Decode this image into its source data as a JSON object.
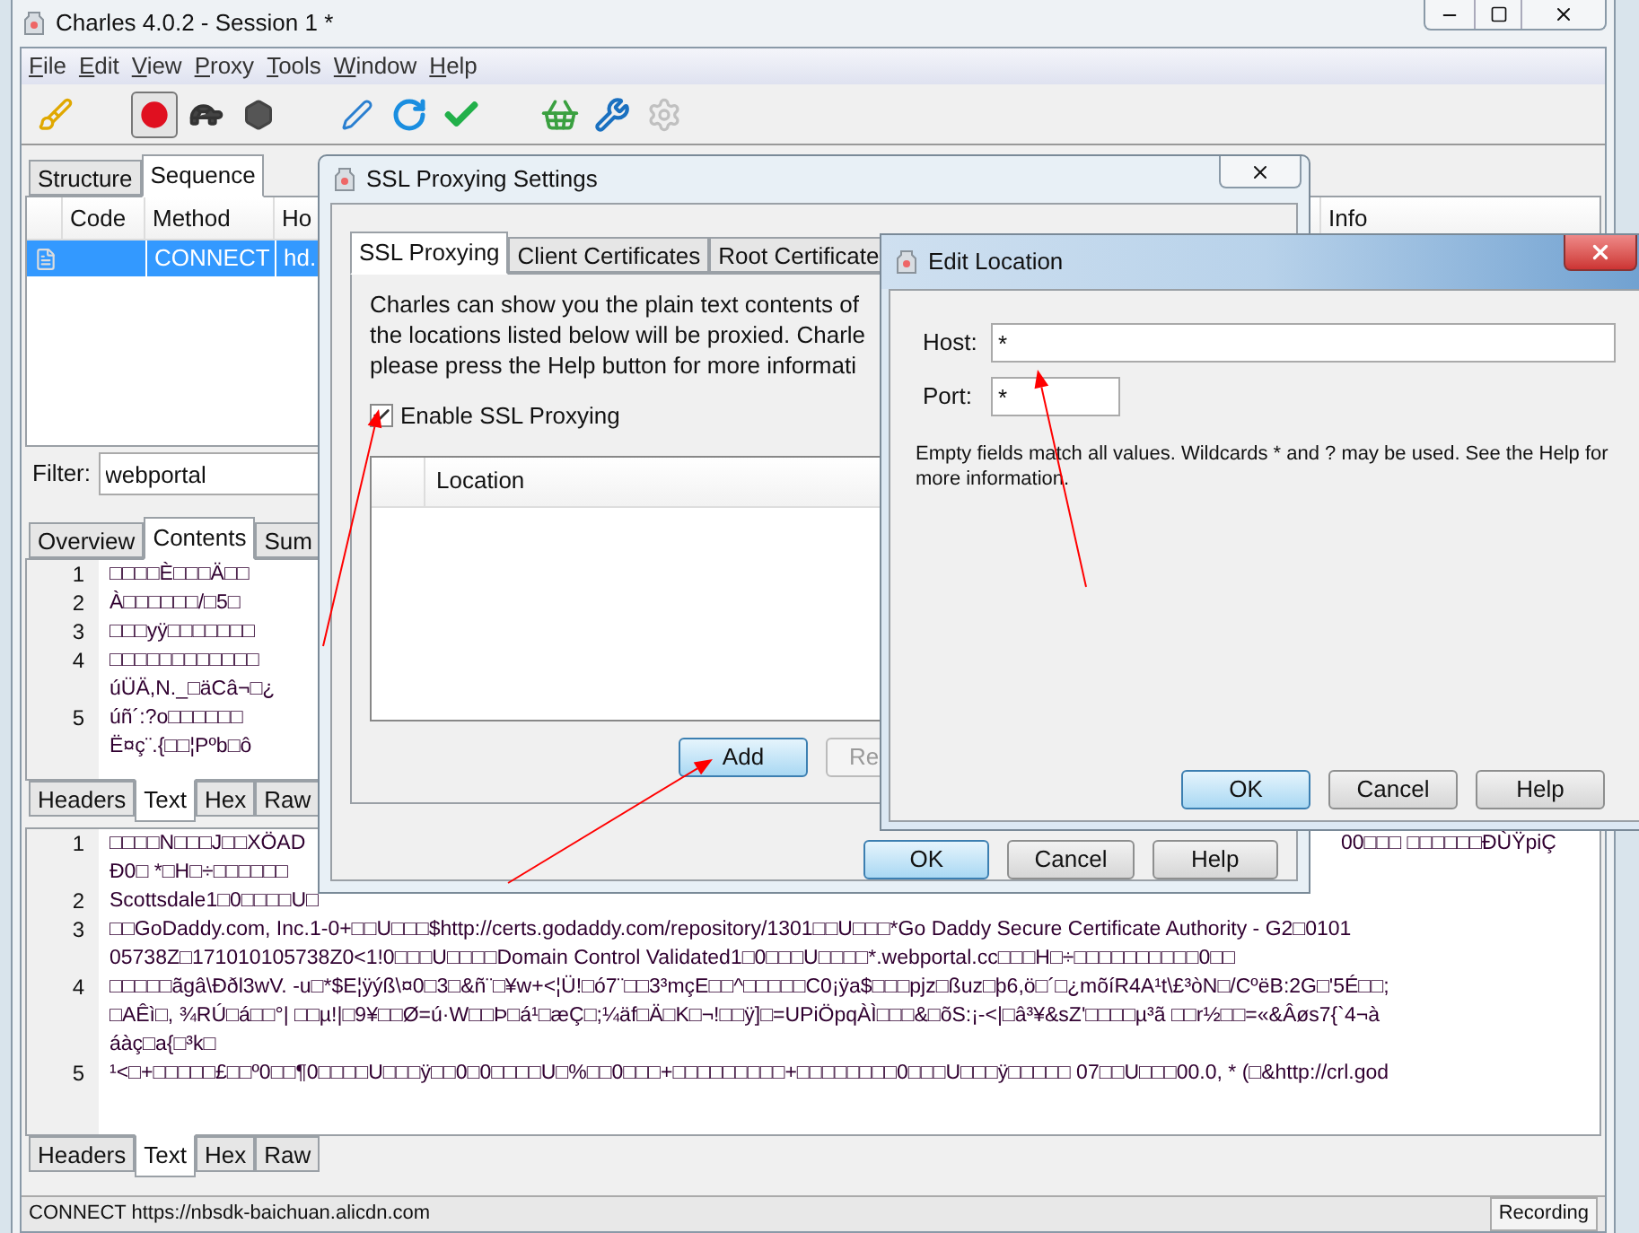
{
  "window": {
    "title": "Charles 4.0.2 - Session 1 *"
  },
  "menu": [
    "File",
    "Edit",
    "View",
    "Proxy",
    "Tools",
    "Window",
    "Help"
  ],
  "toolbar": [
    {
      "pressed": false,
      "disabled": false
    },
    {
      "pressed": true,
      "disabled": false
    },
    {
      "pressed": false,
      "disabled": false
    },
    {
      "pressed": false,
      "disabled": false
    },
    {
      "pressed": false,
      "disabled": false
    },
    {
      "pressed": false,
      "disabled": false
    },
    {
      "pressed": false,
      "disabled": false
    },
    {
      "pressed": false,
      "disabled": false
    },
    {
      "pressed": false,
      "disabled": false
    },
    {
      "pressed": false,
      "disabled": true
    }
  ],
  "view_tabs": [
    {
      "label": "Structure",
      "selected": false
    },
    {
      "label": "Sequence",
      "selected": true
    }
  ],
  "table": {
    "columns": [
      "Code",
      "Method",
      "Ho"
    ],
    "info_column": "Info",
    "rows": [
      {
        "method": "CONNECT",
        "host": "hd.",
        "selected": true
      }
    ]
  },
  "filter": {
    "label": "Filter:",
    "value": "webportal"
  },
  "detail_tabs": [
    {
      "label": "Overview",
      "selected": false
    },
    {
      "label": "Contents",
      "selected": true
    },
    {
      "label": "Sum",
      "selected": false
    }
  ],
  "request_pane": {
    "lines": [
      {
        "number": "1",
        "segments": [
          "□□□□È□□□Ä□□"
        ]
      },
      {
        "number": "2",
        "segments": [
          "À□□□□□□/□5□"
        ]
      },
      {
        "number": "3",
        "segments": [
          "□□□yÿ□□□□□□□"
        ]
      },
      {
        "number": "4",
        "segments": [
          "□□□□□□□□□□□□"
        ]
      },
      {
        "segments": [
          "úÜÄ,N._□äCâ¬□¿"
        ]
      },
      {
        "number": "5",
        "segments": [
          "úñ´:?o□□□□□□"
        ]
      },
      {
        "segments": [
          "Ë¤ç¨.{□□¦Pºb□ô"
        ]
      }
    ],
    "tabs": [
      {
        "label": "Headers",
        "selected": false
      },
      {
        "label": "Text",
        "selected": true
      },
      {
        "label": "Hex",
        "selected": false
      },
      {
        "label": "Raw",
        "selected": false
      }
    ]
  },
  "response_pane": {
    "lines": [
      {
        "number": "1",
        "segments": [
          "□□□□N□□□J□□XÖAD",
          "00□□□ □□□□□□ÐÙŸpiÇ"
        ]
      },
      {
        "segments": [
          "Ð0□    *□H□÷□□□□□□"
        ]
      },
      {
        "number": "2",
        "segments": [
          "Scottsdale1□0□□□□U□"
        ]
      },
      {
        "number": "3",
        "segments": [
          "□□GoDaddy.com, Inc.1-0+□□U□□□$http://certs.godaddy.com/repository/1301□□U□□□*Go Daddy Secure Certificate Authority - G2□0101"
        ]
      },
      {
        "segments": [
          "05738Z□171010105738Z0<1!0□□□U□□□□Domain Control Validated1□0□□□U□□□□*.webportal.cc□□□H□÷□□□□□□□□□□0□□"
        ]
      },
      {
        "number": "4",
        "segments": [
          "□□□□□ãgâ\\Ððl3wV. -u□*$E¦ÿýß\\¤0□3□&ñ¨□¥w+<¦Ü!□ó7¨□□3³mçE□□^□□□□□C0¡ÿa$□□□pjz□ßuz□þ6,ö□´□¿mõíR4A¹t\\£³òN□/CºëB:2G□'5É□□;"
        ]
      },
      {
        "segments": [
          "□AÊì□, ¾RÚ□á□□°| □□µ!|□9¥□□Ø=ú·W□□Þ□á¹□æÇ□;¼äf□Ä□K□¬!□□ÿ]□=UPiÖpqÀÌ□□□&□õS:¡-<|□â³¥&sZ'□□□□µ³ã □□r½□□=«&Âøs7{`4¬à"
        ]
      },
      {
        "segments": [
          "áàç□a{□³k□"
        ]
      },
      {
        "number": "5",
        "segments": [
          "¹<□+□□□□□£□□º0□□¶0□□□□U□□□ÿ□□0□0□□□□U□%□□0□□□+□□□□□□□□□+□□□□□□□□0□□□U□□□ÿ□□□□□ 07□□U□□□00.0, * (□&http://crl.god"
        ]
      }
    ],
    "tabs": [
      {
        "label": "Headers",
        "selected": false
      },
      {
        "label": "Text",
        "selected": true
      },
      {
        "label": "Hex",
        "selected": false
      },
      {
        "label": "Raw",
        "selected": false
      }
    ]
  },
  "status_bar": {
    "text": "CONNECT https://nbsdk-baichuan.alicdn.com",
    "recording": "Recording"
  },
  "ssl_dialog": {
    "title": "SSL Proxying Settings",
    "tabs": [
      {
        "label": "SSL Proxying",
        "selected": true
      },
      {
        "label": "Client Certificates",
        "selected": false
      },
      {
        "label": "Root Certificate",
        "selected": false
      }
    ],
    "description": [
      "Charles can show you the plain text contents of",
      "the locations listed below will be proxied. Charle",
      "please press the Help button for more informati"
    ],
    "enable": {
      "label": "Enable SSL Proxying",
      "checked": true
    },
    "table": {
      "columns": [
        "Location"
      ]
    },
    "list_buttons": [
      "Add",
      "Re"
    ],
    "buttons": [
      {
        "label": "OK",
        "default": true
      },
      {
        "label": "Cancel",
        "default": false
      },
      {
        "label": "Help",
        "default": false
      }
    ]
  },
  "edit_location": {
    "title": "Edit Location",
    "host": {
      "label": "Host:",
      "value": "*"
    },
    "port": {
      "label": "Port:",
      "value": "*"
    },
    "hint": "Empty fields match all values. Wildcards * and ? may be used. See the Help for more information.",
    "buttons": [
      {
        "label": "OK",
        "default": true
      },
      {
        "label": "Cancel",
        "default": false
      },
      {
        "label": "Help",
        "default": false
      }
    ]
  }
}
